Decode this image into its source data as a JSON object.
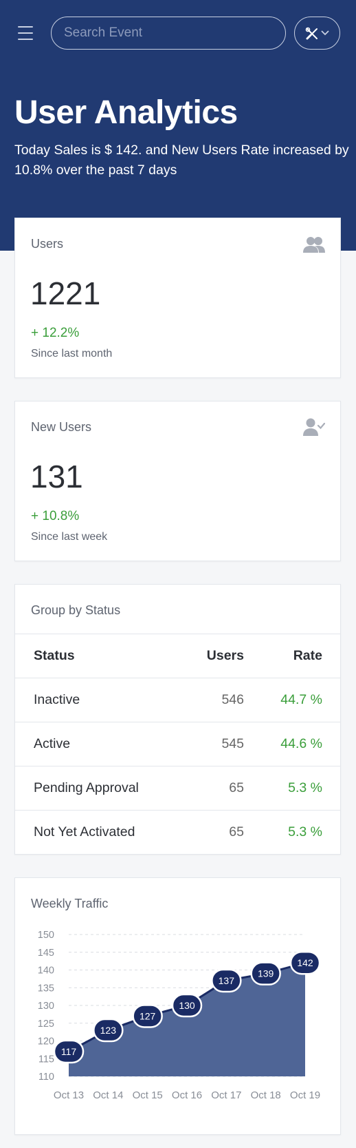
{
  "header": {
    "search_placeholder": "Search Event",
    "title": "User Analytics",
    "subtitle": "Today Sales is $ 142. and New Users Rate increased by 10.8% over the past 7 days"
  },
  "colors": {
    "hero_bg": "#213a72",
    "positive": "#3a9e3a",
    "chart_fill": "#4f6596",
    "chart_marker": "#1a2b64"
  },
  "icons": {
    "menu": "hamburger-icon",
    "tools": "tools-icon",
    "users": "users-icon",
    "new_user": "user-check-icon"
  },
  "users_card": {
    "label": "Users",
    "value": "1221",
    "change": "+ 12.2%",
    "note": "Since last month"
  },
  "new_users_card": {
    "label": "New Users",
    "value": "131",
    "change": "+ 10.8%",
    "note": "Since last week"
  },
  "status_table": {
    "label": "Group by Status",
    "headers": [
      "Status",
      "Users",
      "Rate"
    ],
    "rows": [
      {
        "status": "Inactive",
        "users": "546",
        "rate": "44.7 %"
      },
      {
        "status": "Active",
        "users": "545",
        "rate": "44.6 %"
      },
      {
        "status": "Pending Approval",
        "users": "65",
        "rate": "5.3 %"
      },
      {
        "status": "Not Yet Activated",
        "users": "65",
        "rate": "5.3 %"
      }
    ]
  },
  "traffic_card": {
    "label": "Weekly Traffic"
  },
  "chart_data": {
    "type": "area",
    "title": "Weekly Traffic",
    "categories": [
      "Oct 13",
      "Oct 14",
      "Oct 15",
      "Oct 16",
      "Oct 17",
      "Oct 18",
      "Oct 19"
    ],
    "series": [
      {
        "values": [
          117,
          123,
          127,
          130,
          137,
          139,
          142
        ]
      }
    ],
    "ylim": [
      110,
      150
    ],
    "yticks": [
      110,
      115,
      120,
      125,
      130,
      135,
      140,
      145,
      150
    ],
    "grid": true,
    "data_labels": true
  }
}
